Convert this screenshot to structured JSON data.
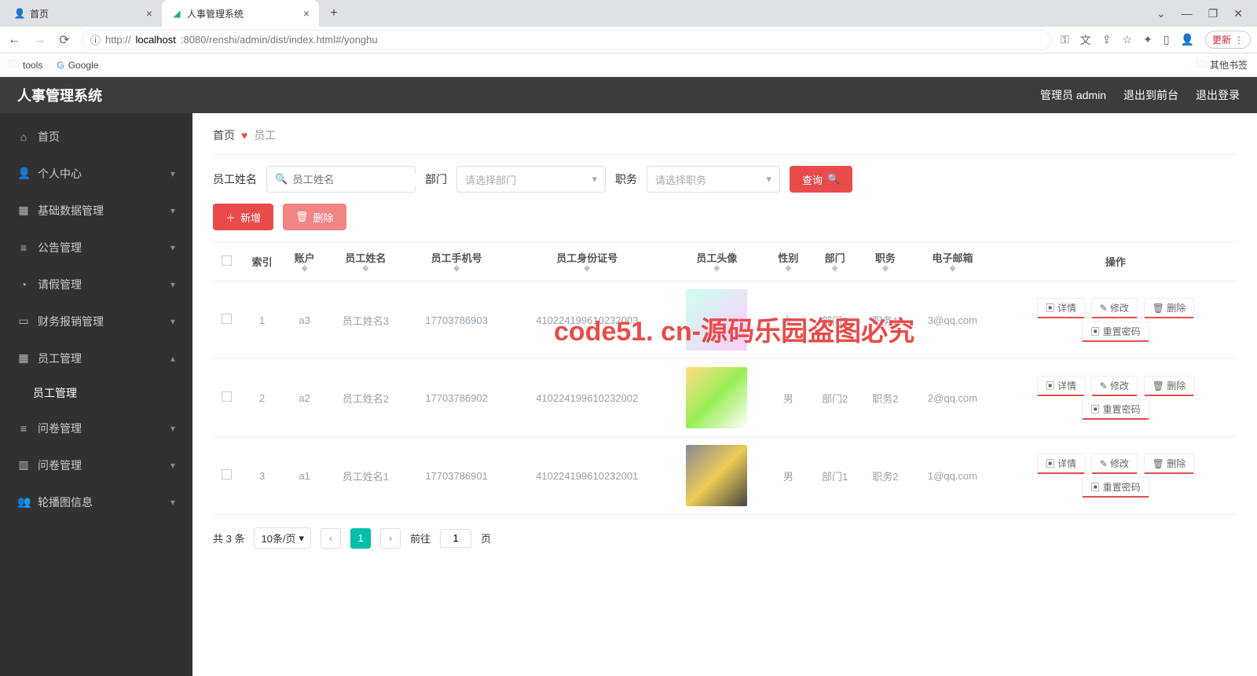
{
  "browser": {
    "tabs": [
      {
        "title": "首页"
      },
      {
        "title": "人事管理系统"
      }
    ],
    "url_proto": "http://",
    "url_host": "localhost",
    "url_path": ":8080/renshi/admin/dist/index.html#/yonghu",
    "update_label": "更新",
    "bookmarks": {
      "tools": "tools",
      "google": "Google",
      "other": "其他书签"
    }
  },
  "header": {
    "title": "人事管理系统",
    "admin": "管理员 admin",
    "front": "退出到前台",
    "logout": "退出登录"
  },
  "sidebar": {
    "items": [
      {
        "label": "首页",
        "icon": "⌂"
      },
      {
        "label": "个人中心",
        "icon": "👤",
        "caret": true
      },
      {
        "label": "基础数据管理",
        "icon": "▦",
        "caret": true
      },
      {
        "label": "公告管理",
        "icon": "≡",
        "caret": true
      },
      {
        "label": "请假管理",
        "icon": "◔",
        "caret": true
      },
      {
        "label": "财务报销管理",
        "icon": "▭",
        "caret": true
      },
      {
        "label": "员工管理",
        "icon": "▦",
        "caret": true,
        "expanded": true
      },
      {
        "label": "问卷管理",
        "icon": "≡",
        "caret": true
      },
      {
        "label": "问卷管理",
        "icon": "▥",
        "caret": true
      },
      {
        "label": "轮播图信息",
        "icon": "👥",
        "caret": true
      }
    ],
    "sub": "员工管理"
  },
  "breadcrumb": {
    "home": "首页",
    "current": "员工"
  },
  "search": {
    "name_label": "员工姓名",
    "name_placeholder": "员工姓名",
    "dept_label": "部门",
    "dept_placeholder": "请选择部门",
    "role_label": "职务",
    "role_placeholder": "请选择职务",
    "query": "查询",
    "add": "新增",
    "del": "删除"
  },
  "table": {
    "cols": [
      "",
      "索引",
      "账户",
      "员工姓名",
      "员工手机号",
      "员工身份证号",
      "员工头像",
      "性别",
      "部门",
      "职务",
      "电子邮箱",
      "操作"
    ],
    "rows": [
      {
        "idx": "1",
        "acct": "a3",
        "name": "员工姓名3",
        "phone": "17703786903",
        "idno": "410224199610232003",
        "gender": "女",
        "dept": "部门3",
        "role": "职务1",
        "email": "3@qq.com"
      },
      {
        "idx": "2",
        "acct": "a2",
        "name": "员工姓名2",
        "phone": "17703786902",
        "idno": "410224199610232002",
        "gender": "男",
        "dept": "部门2",
        "role": "职务2",
        "email": "2@qq.com"
      },
      {
        "idx": "3",
        "acct": "a1",
        "name": "员工姓名1",
        "phone": "17703786901",
        "idno": "410224199610232001",
        "gender": "男",
        "dept": "部门1",
        "role": "职务2",
        "email": "1@qq.com"
      }
    ],
    "actions": {
      "detail": "详情",
      "edit": "修改",
      "del": "删除",
      "reset": "重置密码"
    }
  },
  "pagination": {
    "total": "共 3 条",
    "page_size": "10条/页",
    "current": "1",
    "goto_label_pre": "前往",
    "goto_label_post": "页",
    "goto_val": "1"
  },
  "watermark_big": "code51. cn-源码乐园盗图必究"
}
